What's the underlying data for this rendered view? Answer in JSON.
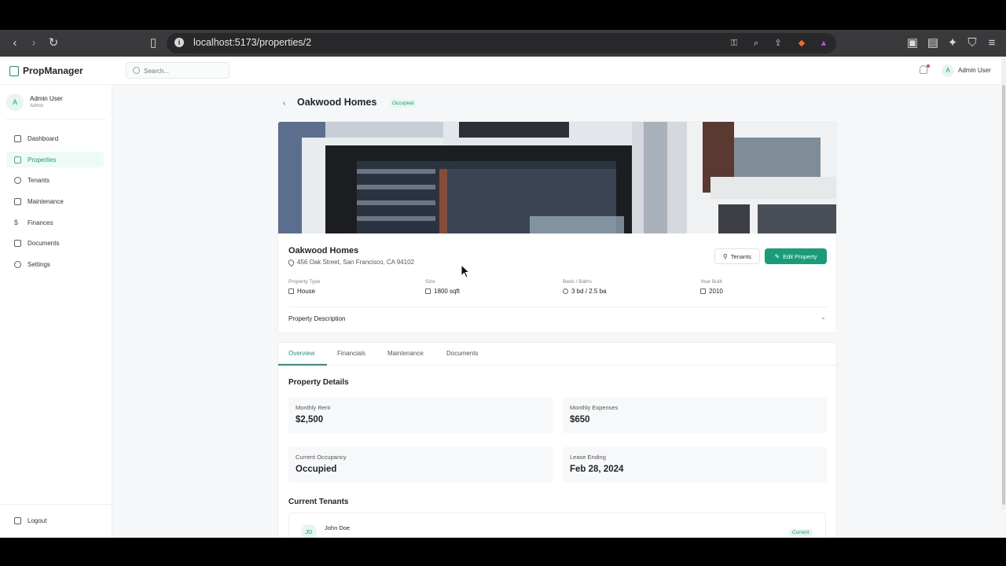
{
  "browser": {
    "url": "localhost:5173/properties/2"
  },
  "app": {
    "brand": "PropManager",
    "search_placeholder": "Search...",
    "top_user": "Admin User",
    "top_avatar": "A"
  },
  "sidebar": {
    "user": {
      "avatar": "A",
      "name": "Admin User",
      "role": "Admin"
    },
    "items": [
      {
        "label": "Dashboard",
        "icon": "home-icon",
        "active": false
      },
      {
        "label": "Properties",
        "icon": "building-icon",
        "active": true
      },
      {
        "label": "Tenants",
        "icon": "users-icon",
        "active": false
      },
      {
        "label": "Maintenance",
        "icon": "wrench-icon",
        "active": false
      },
      {
        "label": "Finances",
        "icon": "dollar-icon",
        "active": false
      },
      {
        "label": "Documents",
        "icon": "document-icon",
        "active": false
      },
      {
        "label": "Settings",
        "icon": "gear-icon",
        "active": false
      }
    ],
    "logout": "Logout"
  },
  "page": {
    "title": "Oakwood Homes",
    "status": "Occupied"
  },
  "property": {
    "name": "Oakwood Homes",
    "address": "456 Oak Street, San Francisco, CA 94102",
    "tenants_button": "Tenants",
    "edit_button": "Edit Property",
    "stats": [
      {
        "label": "Property Type",
        "value": "House"
      },
      {
        "label": "Size",
        "value": "1800 sqft"
      },
      {
        "label": "Beds / Baths",
        "value": "3 bd / 2.5 ba"
      },
      {
        "label": "Year Built",
        "value": "2010"
      }
    ],
    "description_label": "Property Description"
  },
  "tabs": [
    "Overview",
    "Financials",
    "Maintenance",
    "Documents"
  ],
  "details": {
    "title": "Property Details",
    "items": [
      {
        "label": "Monthly Rent",
        "value": "$2,500"
      },
      {
        "label": "Monthly Expenses",
        "value": "$650"
      },
      {
        "label": "Current Occupancy",
        "value": "Occupied"
      },
      {
        "label": "Lease Ending",
        "value": "Feb 28, 2024"
      }
    ]
  },
  "tenants": {
    "title": "Current Tenants",
    "rows": [
      {
        "initials": "JD",
        "name": "John Doe",
        "status": "Current"
      }
    ]
  },
  "colors": {
    "accent": "#1a9b7a",
    "browser_chrome": "#3a3a3c"
  }
}
